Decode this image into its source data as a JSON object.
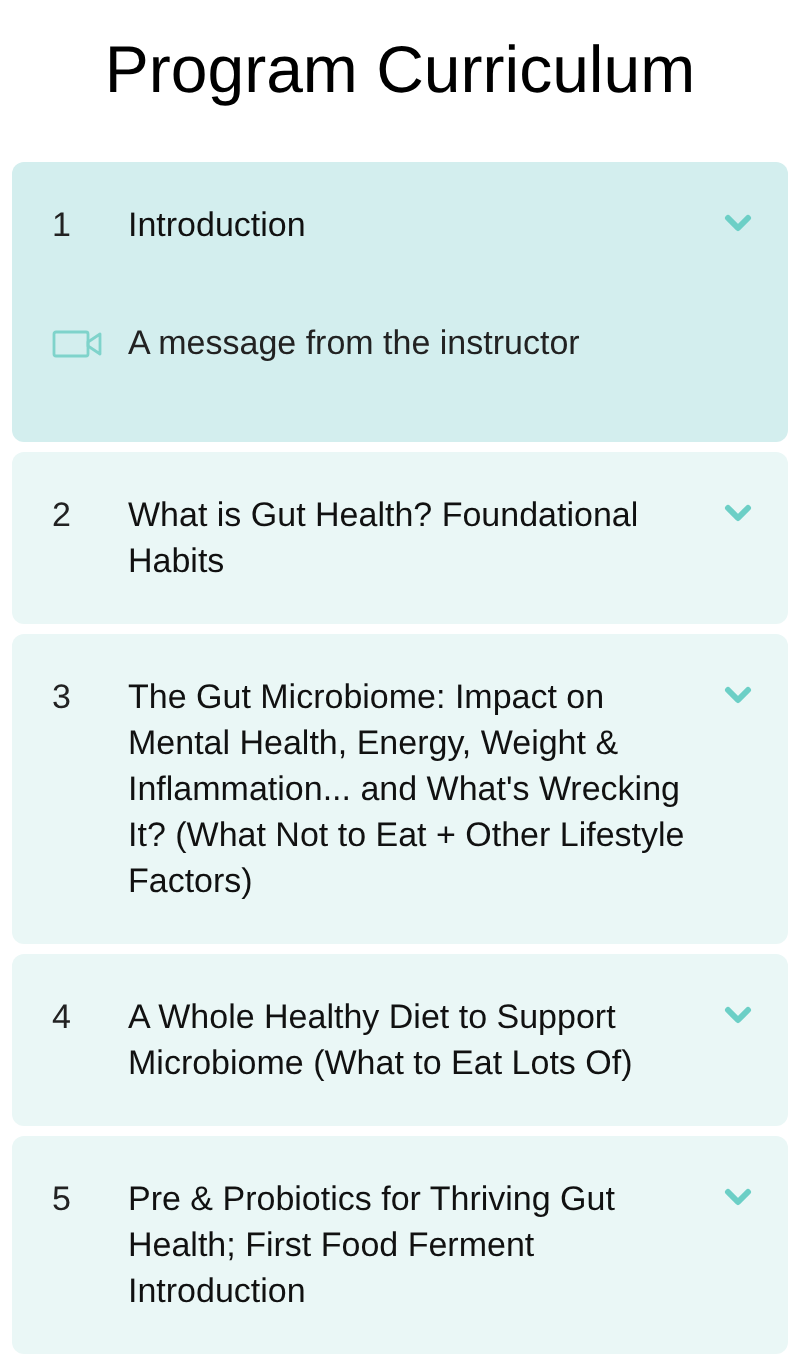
{
  "title": "Program Curriculum",
  "modules": [
    {
      "number": "1",
      "title": "Introduction",
      "expanded": true,
      "lessons": [
        {
          "kind": "video",
          "title": "A message from the instructor"
        }
      ]
    },
    {
      "number": "2",
      "title": "What is Gut Health? Foundational Habits",
      "expanded": false
    },
    {
      "number": "3",
      "title": "The Gut Microbiome: Impact on Mental Health, Energy, Weight & Inflammation... and What's Wrecking It? (What Not to Eat + Other Lifestyle Factors)",
      "expanded": false
    },
    {
      "number": "4",
      "title": "A Whole Healthy Diet to Support Microbiome (What to Eat Lots Of)",
      "expanded": false
    },
    {
      "number": "5",
      "title": "Pre & Probiotics for Thriving Gut Health; First Food Ferment Introduction",
      "expanded": false
    }
  ]
}
